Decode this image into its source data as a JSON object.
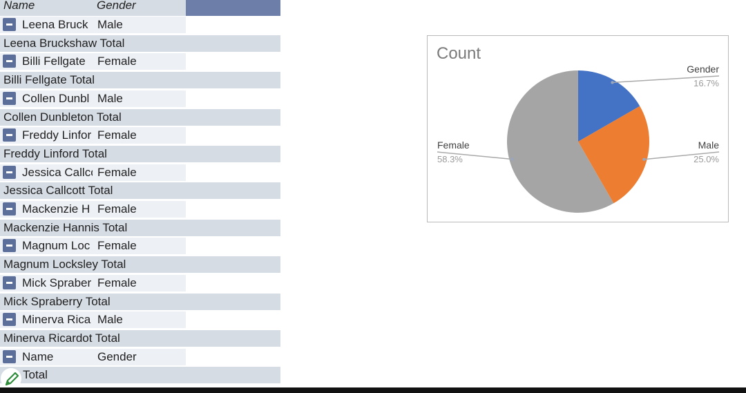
{
  "pivot": {
    "header": {
      "name": "Name",
      "gender": "Gender"
    },
    "rows": [
      {
        "type": "detail",
        "name": "Leena Bruck",
        "gender": "Male"
      },
      {
        "type": "total",
        "label": " Leena Bruckshaw Total"
      },
      {
        "type": "detail",
        "name": "Billi Fellgate",
        "gender": "Female"
      },
      {
        "type": "total",
        "label": "Billi Fellgate Total"
      },
      {
        "type": "detail",
        "name": "Collen Dunbl",
        "gender": "Male"
      },
      {
        "type": "total",
        "label": "Collen Dunbleton Total"
      },
      {
        "type": "detail",
        "name": "Freddy Linfor",
        "gender": "Female"
      },
      {
        "type": "total",
        "label": "Freddy Linford Total"
      },
      {
        "type": "detail",
        "name": "Jessica Callcc",
        "gender": "Female"
      },
      {
        "type": "total",
        "label": "Jessica Callcott Total"
      },
      {
        "type": "detail",
        "name": "Mackenzie H",
        "gender": "Female"
      },
      {
        "type": "total",
        "label": "Mackenzie Hannis Total"
      },
      {
        "type": "detail",
        "name": "Magnum Loc",
        "gender": "Female"
      },
      {
        "type": "total",
        "label": "Magnum Locksley Total"
      },
      {
        "type": "detail",
        "name": "Mick Spraber",
        "gender": "Female"
      },
      {
        "type": "total",
        "label": "Mick Spraberry Total"
      },
      {
        "type": "detail",
        "name": "Minerva Rica",
        "gender": "Male"
      },
      {
        "type": "total",
        "label": "Minerva Ricardot Total"
      },
      {
        "type": "detail",
        "name": "Name",
        "gender": "Gender"
      },
      {
        "type": "total",
        "label": "me Total"
      }
    ]
  },
  "chart_data": {
    "type": "pie",
    "title": "Count",
    "slices": [
      {
        "label": "Gender",
        "value": 16.7,
        "display": "16.7%",
        "color": "#4472c4"
      },
      {
        "label": "Male",
        "value": 25.0,
        "display": "25.0%",
        "color": "#ed7d31"
      },
      {
        "label": "Female",
        "value": 58.3,
        "display": "58.3%",
        "color": "#a5a5a5"
      }
    ],
    "start_angle": "12 o'clock",
    "direction": "clockwise",
    "legend": "none",
    "data_label_position": "outside-with-leader-lines"
  },
  "icons": {
    "collapse": "minus-box-icon",
    "edit": "pencil-icon"
  },
  "colors": {
    "header_accent": "#6d7fa8",
    "total_row": "#d6dce4",
    "detail_row": "#edf0f5",
    "collapse_button": "#5b6f9a"
  }
}
